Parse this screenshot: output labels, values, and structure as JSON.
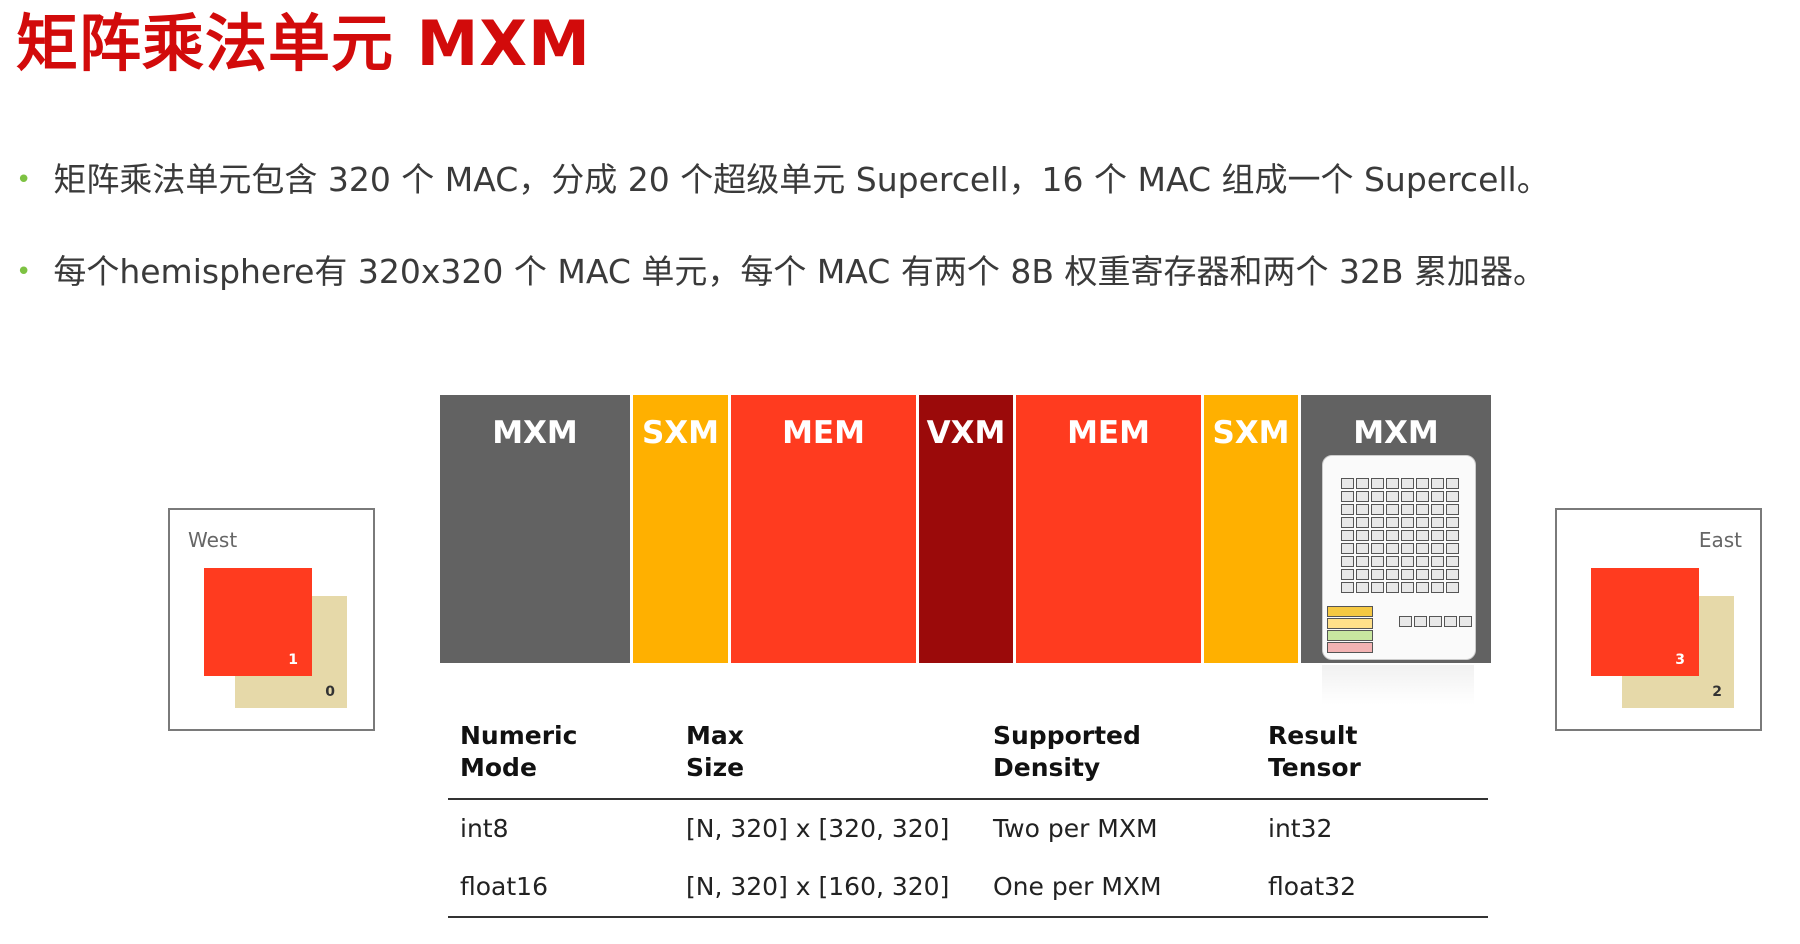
{
  "title": "矩阵乘法单元 MXM",
  "bullets": [
    "矩阵乘法单元包含 320 个 MAC，分成 20 个超级单元 Supercell，16 个 MAC 组成一个 Supercell。",
    "每个hemisphere有 320x320 个 MAC 单元，每个 MAC 有两个 8B 权重寄存器和两个 32B 累加器。"
  ],
  "blocks": [
    {
      "label": "MXM",
      "color": "#626262"
    },
    {
      "label": "SXM",
      "color": "#ffb000"
    },
    {
      "label": "MEM",
      "color": "#ff3b1f"
    },
    {
      "label": "VXM",
      "color": "#9b0a0a"
    },
    {
      "label": "MEM",
      "color": "#ff3b1f"
    },
    {
      "label": "SXM",
      "color": "#ffb000"
    },
    {
      "label": "MXM",
      "color": "#626262"
    }
  ],
  "west": {
    "label": "West",
    "front_num": "1",
    "back_num": "0"
  },
  "east": {
    "label": "East",
    "front_num": "3",
    "back_num": "2"
  },
  "table": {
    "headers": [
      [
        "Numeric",
        "Mode"
      ],
      [
        "Max",
        "Size"
      ],
      [
        "Supported",
        "Density"
      ],
      [
        "Result",
        "Tensor"
      ]
    ],
    "rows": [
      [
        "int8",
        "[N, 320] x [320, 320]",
        "Two per MXM",
        "int32"
      ],
      [
        "float16",
        "[N, 320] x [160, 320]",
        "One per MXM",
        "float32"
      ]
    ]
  }
}
